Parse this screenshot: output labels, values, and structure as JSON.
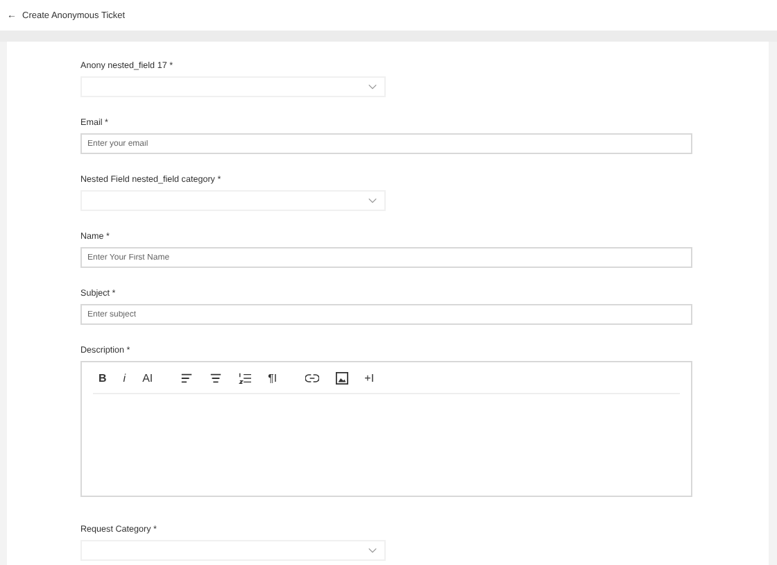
{
  "header": {
    "back": "←",
    "title": "Create Anonymous Ticket"
  },
  "fields": [
    {
      "kind": "select",
      "label": "Anony nested_field 17 *"
    },
    {
      "kind": "input",
      "label": "Email *",
      "placeholder": "Enter your email"
    },
    {
      "kind": "select",
      "label": "Nested Field nested_field category *"
    },
    {
      "kind": "input",
      "label": "Name *",
      "placeholder": "Enter Your First Name"
    },
    {
      "kind": "input",
      "label": "Subject *",
      "placeholder": "Enter subject"
    },
    {
      "kind": "editor",
      "label": "Description *",
      "toolbar": [
        [
          {
            "kind": "bold",
            "label": "B"
          },
          {
            "kind": "italic",
            "label": "i"
          },
          {
            "kind": "text",
            "label": "AI"
          }
        ],
        [
          {
            "kind": "align-left"
          },
          {
            "kind": "align-center"
          },
          {
            "kind": "numbered-list"
          },
          {
            "kind": "text",
            "label": "¶I"
          }
        ],
        [
          {
            "kind": "link"
          },
          {
            "kind": "image"
          },
          {
            "kind": "text",
            "label": "+I"
          }
        ]
      ]
    },
    {
      "kind": "select",
      "label": "Request Category *"
    }
  ]
}
